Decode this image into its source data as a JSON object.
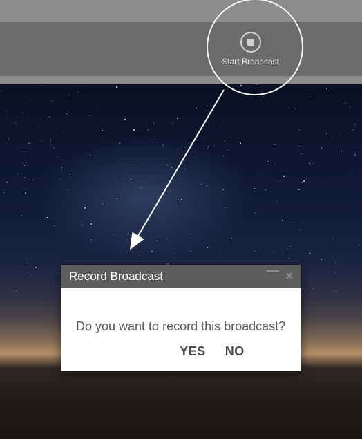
{
  "toolbar": {
    "broadcast_label": "Start Broadcast"
  },
  "modal": {
    "title": "Record Broadcast",
    "message": "Do you want to record this broadcast?",
    "yes_label": "YES",
    "no_label": "NO"
  }
}
